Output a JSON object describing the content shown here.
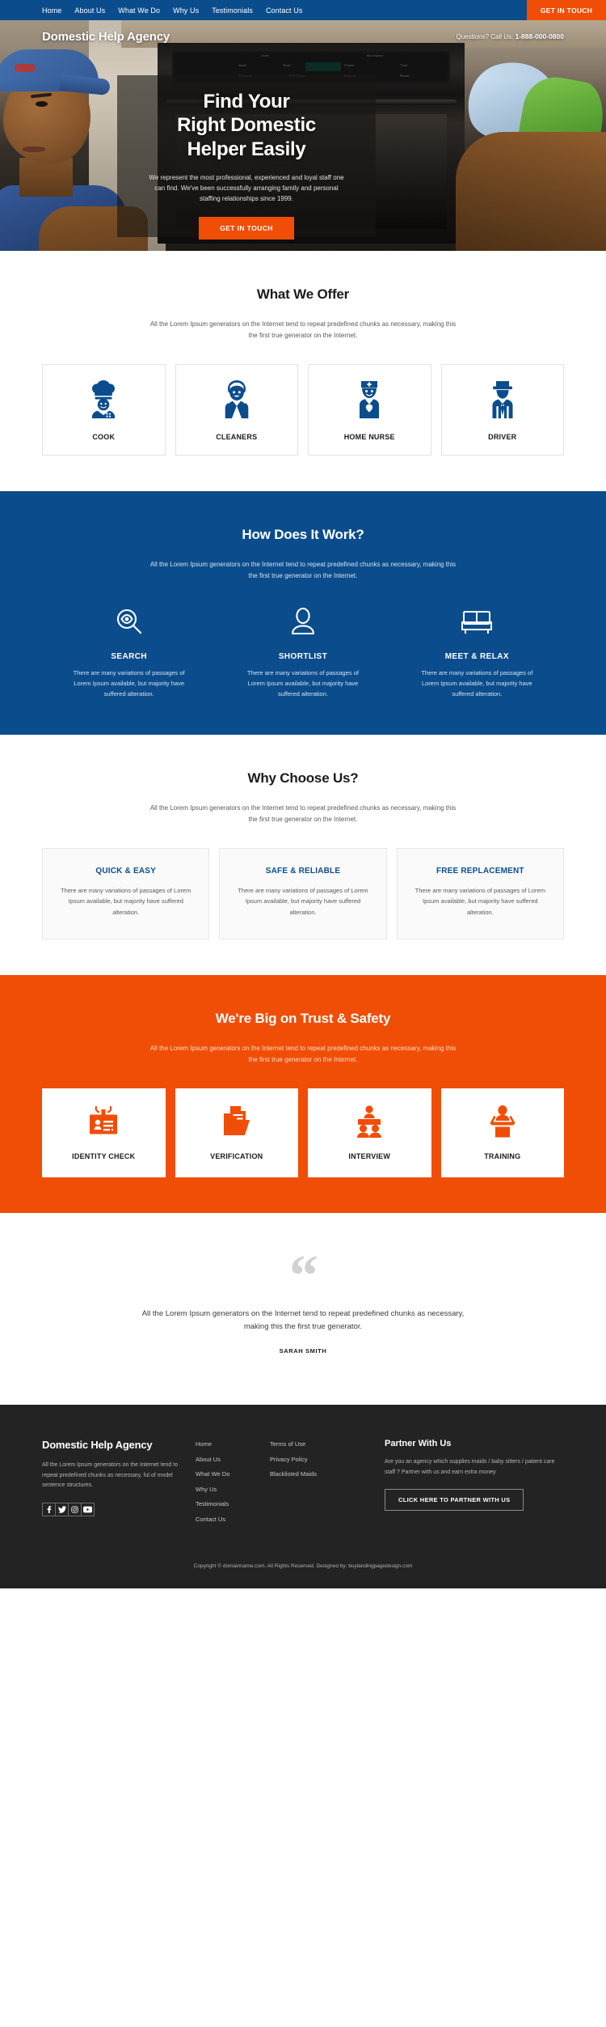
{
  "nav": {
    "items": [
      "Home",
      "About Us",
      "What We Do",
      "Why Us",
      "Testimonials",
      "Contact Us"
    ],
    "cta_label": "GET IN TOUCH"
  },
  "header": {
    "brand": "Domestic Help Agency",
    "questions_label": "Questions? Call Us:",
    "phone": "1-888-000-0800"
  },
  "hero": {
    "title_line1": "Find Your",
    "title_line2": "Right Domestic",
    "title_line3": "Helper Easily",
    "description": "We represent the most professional, experienced and loyal staff one can find. We've been successfully arranging family and personal staffing relationships since 1999.",
    "cta_label": "GET IN TOUCH"
  },
  "offer": {
    "title": "What We Offer",
    "description": "All the Lorem Ipsum generators on the Internet tend to repeat predefined chunks as necessary, making this the first true generator on the Internet.",
    "cards": [
      {
        "label": "COOK",
        "icon": "chef-icon"
      },
      {
        "label": "CLEANERS",
        "icon": "maid-icon"
      },
      {
        "label": "HOME NURSE",
        "icon": "nurse-icon"
      },
      {
        "label": "DRIVER",
        "icon": "driver-icon"
      }
    ]
  },
  "how": {
    "title": "How Does It Work?",
    "description": "All the Lorem Ipsum generators on the Internet tend to repeat predefined chunks as necessary, making this the first true generator on the Internet.",
    "steps": [
      {
        "name": "SEARCH",
        "icon": "search-eye-icon",
        "desc": "There are many variations of passages of Lorem Ipsum available, but majority have suffered alteration."
      },
      {
        "name": "SHORTLIST",
        "icon": "person-icon",
        "desc": "There are many variations of passages of Lorem Ipsum available, but majority have suffered alteration."
      },
      {
        "name": "MEET & RELAX",
        "icon": "sofa-icon",
        "desc": "There are many variations of passages of Lorem Ipsum available, but majority have suffered alteration."
      }
    ]
  },
  "why": {
    "title": "Why Choose Us?",
    "description": "All the Lorem Ipsum generators on the Internet tend to repeat predefined chunks as necessary, making this the first true generator on the Internet.",
    "cards": [
      {
        "title": "QUICK & EASY",
        "desc": "There are many variations of passages of Lorem Ipsum available, but majority have suffered alteration."
      },
      {
        "title": "SAFE & RELIABLE",
        "desc": "There are many variations of passages of Lorem Ipsum available, but majority have suffered alteration."
      },
      {
        "title": "FREE REPLACEMENT",
        "desc": "There are many variations of passages of Lorem Ipsum available, but majority have suffered alteration."
      }
    ]
  },
  "trust": {
    "title": "We're Big on Trust & Safety",
    "description": "All the Lorem Ipsum generators on the Internet tend to repeat predefined chunks as necessary, making this the first true generator on the Internet.",
    "cards": [
      {
        "label": "IDENTITY CHECK",
        "icon": "id-card-icon"
      },
      {
        "label": "VERIFICATION",
        "icon": "folder-document-icon"
      },
      {
        "label": "INTERVIEW",
        "icon": "interview-panel-icon"
      },
      {
        "label": "TRAINING",
        "icon": "podium-trainer-icon"
      }
    ]
  },
  "testimonial": {
    "quote_glyph": "“",
    "text": "All the Lorem Ipsum generators on the Internet tend to repeat predefined chunks as necessary, making this the first true generator.",
    "author": "SARAH SMITH"
  },
  "footer": {
    "brand": "Domestic Help Agency",
    "about": "All the Lorem Ipsum generators on the Internet tend to repeat predefined chunks as necessary, ful of model sentence structures.",
    "socials": [
      "facebook-icon",
      "twitter-icon",
      "instagram-icon",
      "youtube-icon"
    ],
    "links_col1": [
      "Home",
      "About Us",
      "What We Do",
      "Why Us",
      "Testimonials",
      "Contact Us"
    ],
    "links_col2": [
      "Terms of Use",
      "Privacy Policy",
      "Blacklisted Maids"
    ],
    "partner_title": "Partner With Us",
    "partner_text": "Are you an agency which supplies maids / baby sitters / patient care staff ? Partner with us and earn extra money",
    "partner_btn": "CLICK HERE TO PARTNER WITH US",
    "copyright": "Copyright © domainname.com. All Rights Reserved. Designed by: buylandingpagedesign.com"
  },
  "colors": {
    "brand_blue": "#0b4d8c",
    "brand_orange": "#f04e06",
    "footer_dark": "#232323"
  }
}
